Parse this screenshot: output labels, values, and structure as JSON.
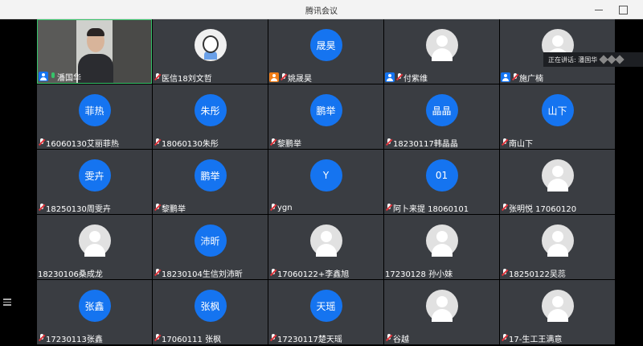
{
  "window": {
    "title": "腾讯会议"
  },
  "speaking": {
    "label": "正在讲话: 潘国华"
  },
  "tiles": [
    {
      "name": "潘国华",
      "avatar": "video",
      "avatar_text": "",
      "badge": "host",
      "mic": "active"
    },
    {
      "name": "医信18刘文哲",
      "avatar": "image",
      "avatar_text": "",
      "badge": "",
      "mic": "muted"
    },
    {
      "name": "姚晟昊",
      "avatar": "blue",
      "avatar_text": "晟昊",
      "badge": "cohost",
      "mic": "muted"
    },
    {
      "name": "付紫维",
      "avatar": "gray",
      "avatar_text": "",
      "badge": "host",
      "mic": "muted"
    },
    {
      "name": "施广楠",
      "avatar": "gray",
      "avatar_text": "",
      "badge": "host",
      "mic": "muted"
    },
    {
      "name": "16060130艾丽菲热",
      "avatar": "blue",
      "avatar_text": "菲热",
      "badge": "",
      "mic": "muted"
    },
    {
      "name": "18060130朱彤",
      "avatar": "blue",
      "avatar_text": "朱彤",
      "badge": "",
      "mic": "muted"
    },
    {
      "name": "黎鹏举",
      "avatar": "blue",
      "avatar_text": "鹏举",
      "badge": "",
      "mic": "muted"
    },
    {
      "name": "18230117韩晶晶",
      "avatar": "blue",
      "avatar_text": "晶晶",
      "badge": "",
      "mic": "muted"
    },
    {
      "name": "南山下",
      "avatar": "blue",
      "avatar_text": "山下",
      "badge": "",
      "mic": "muted"
    },
    {
      "name": "18250130周雯卉",
      "avatar": "blue",
      "avatar_text": "雯卉",
      "badge": "",
      "mic": "muted"
    },
    {
      "name": "黎鹏举",
      "avatar": "blue",
      "avatar_text": "鹏举",
      "badge": "",
      "mic": "muted"
    },
    {
      "name": "ygn",
      "avatar": "blue",
      "avatar_text": "Y",
      "badge": "",
      "mic": "muted"
    },
    {
      "name": "阿卜来提 18060101",
      "avatar": "blue",
      "avatar_text": "01",
      "badge": "",
      "mic": "muted"
    },
    {
      "name": "张明悦 17060120",
      "avatar": "gray",
      "avatar_text": "",
      "badge": "",
      "mic": "muted"
    },
    {
      "name": "18230106桑成龙",
      "avatar": "gray",
      "avatar_text": "",
      "badge": "",
      "mic": "none"
    },
    {
      "name": "18230104生信刘沛昕",
      "avatar": "blue",
      "avatar_text": "沛昕",
      "badge": "",
      "mic": "muted"
    },
    {
      "name": "17060122+李鑫旭",
      "avatar": "gray",
      "avatar_text": "",
      "badge": "",
      "mic": "muted"
    },
    {
      "name": "17230128 孙小妹",
      "avatar": "gray",
      "avatar_text": "",
      "badge": "",
      "mic": "none"
    },
    {
      "name": "18250122吴蕊",
      "avatar": "gray",
      "avatar_text": "",
      "badge": "",
      "mic": "muted"
    },
    {
      "name": "17230113张鑫",
      "avatar": "blue",
      "avatar_text": "张鑫",
      "badge": "",
      "mic": "muted"
    },
    {
      "name": "17060111 张枫",
      "avatar": "blue",
      "avatar_text": "张枫",
      "badge": "",
      "mic": "muted"
    },
    {
      "name": "17230117楚天瑶",
      "avatar": "blue",
      "avatar_text": "天瑶",
      "badge": "",
      "mic": "muted"
    },
    {
      "name": "谷越",
      "avatar": "gray",
      "avatar_text": "",
      "badge": "",
      "mic": "muted"
    },
    {
      "name": "17-生工王满意",
      "avatar": "gray",
      "avatar_text": "",
      "badge": "",
      "mic": "muted"
    }
  ]
}
